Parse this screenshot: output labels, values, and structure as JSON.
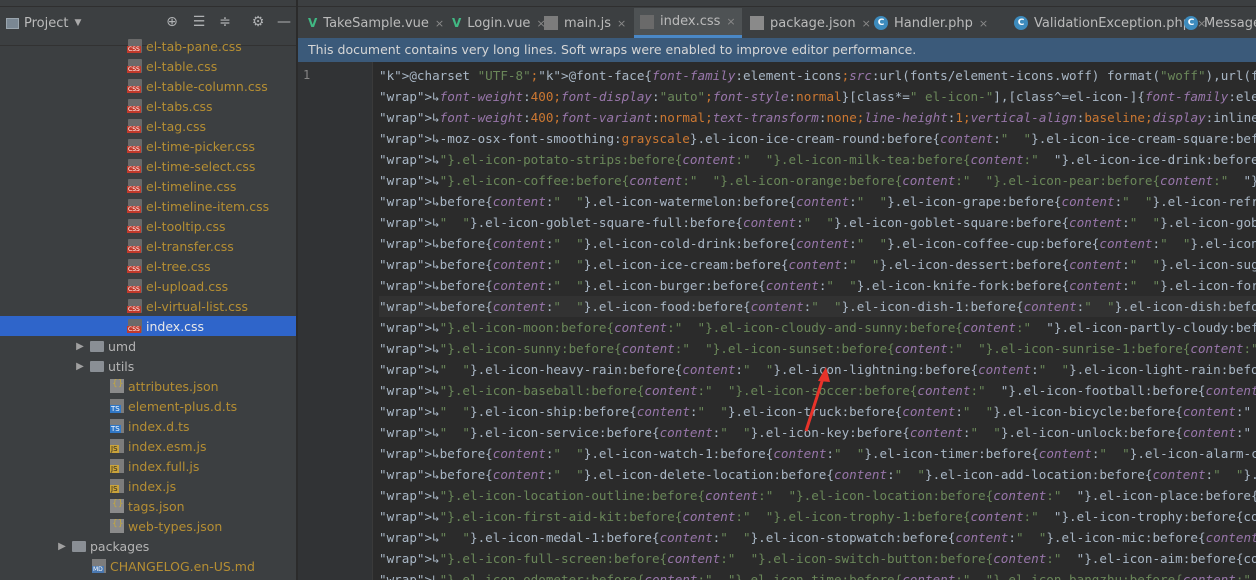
{
  "project": {
    "title": "Project",
    "tree": [
      {
        "label": "el-tab-pane.css",
        "type": "css",
        "indent": 128
      },
      {
        "label": "el-table.css",
        "type": "css",
        "indent": 128
      },
      {
        "label": "el-table-column.css",
        "type": "css",
        "indent": 128
      },
      {
        "label": "el-tabs.css",
        "type": "css",
        "indent": 128
      },
      {
        "label": "el-tag.css",
        "type": "css",
        "indent": 128
      },
      {
        "label": "el-time-picker.css",
        "type": "css",
        "indent": 128
      },
      {
        "label": "el-time-select.css",
        "type": "css",
        "indent": 128
      },
      {
        "label": "el-timeline.css",
        "type": "css",
        "indent": 128
      },
      {
        "label": "el-timeline-item.css",
        "type": "css",
        "indent": 128
      },
      {
        "label": "el-tooltip.css",
        "type": "css",
        "indent": 128
      },
      {
        "label": "el-transfer.css",
        "type": "css",
        "indent": 128
      },
      {
        "label": "el-tree.css",
        "type": "css",
        "indent": 128
      },
      {
        "label": "el-upload.css",
        "type": "css",
        "indent": 128
      },
      {
        "label": "el-virtual-list.css",
        "type": "css",
        "indent": 128
      },
      {
        "label": "index.css",
        "type": "css",
        "indent": 128,
        "selected": true
      },
      {
        "label": "umd",
        "type": "folder",
        "indent": 92
      },
      {
        "label": "utils",
        "type": "folder",
        "indent": 92
      },
      {
        "label": "attributes.json",
        "type": "json",
        "indent": 110
      },
      {
        "label": "element-plus.d.ts",
        "type": "ts",
        "indent": 110
      },
      {
        "label": "index.d.ts",
        "type": "ts",
        "indent": 110
      },
      {
        "label": "index.esm.js",
        "type": "js",
        "indent": 110
      },
      {
        "label": "index.full.js",
        "type": "js",
        "indent": 110
      },
      {
        "label": "index.js",
        "type": "js",
        "indent": 110
      },
      {
        "label": "tags.json",
        "type": "json",
        "indent": 110
      },
      {
        "label": "web-types.json",
        "type": "json",
        "indent": 110
      },
      {
        "label": "packages",
        "type": "folder",
        "indent": 74
      },
      {
        "label": "CHANGELOG.en-US.md",
        "type": "md",
        "indent": 92
      }
    ]
  },
  "tabs": [
    {
      "label": "TakeSample.vue",
      "type": "vue"
    },
    {
      "label": "Login.vue",
      "type": "vue"
    },
    {
      "label": "main.js",
      "type": "js"
    },
    {
      "label": "index.css",
      "type": "css",
      "active": true
    },
    {
      "label": "package.json",
      "type": "json"
    },
    {
      "label": "Handler.php",
      "type": "php"
    },
    {
      "label": "ValidationException.php",
      "type": "php"
    },
    {
      "label": "Message",
      "type": "php"
    }
  ],
  "notice": "This document contains very long lines. Soft wraps were enabled to improve editor performance.",
  "editor": {
    "line_number": "1",
    "lines": [
      "@charset \"UTF-8\";@font-face{font-family:element-icons;src:url(fonts/element-icons.woff) format(\"woff\"),url(font",
      "↳font-weight:400;font-display:\"auto\";font-style:normal}[class*=\" el-icon-\"],[class^=el-icon-]{font-family:elem",
      "↳font-weight:400;font-variant:normal;text-transform:none;line-height:1;vertical-align:baseline;display:inline-",
      "↳-moz-osx-font-smoothing:grayscale}.el-icon-ice-cream-round:before{content:\"  \"}.el-icon-ice-cream-square:befo",
      "↳\"}.el-icon-potato-strips:before{content:\"  \"}.el-icon-milk-tea:before{content:\"  \"}.el-icon-ice-drink:before{",
      "↳\"}.el-icon-coffee:before{content:\"  \"}.el-icon-orange:before{content:\"  \"}.el-icon-pear:before{content:\"  \"}.",
      "↳before{content:\"  \"}.el-icon-watermelon:before{content:\"  \"}.el-icon-grape:before{content:\"  \"}.el-icon-refri",
      "↳\"  \"}.el-icon-goblet-square-full:before{content:\"  \"}.el-icon-goblet-square:before{content:\"  \"}.el-icon-gobl",
      "↳before{content:\"  \"}.el-icon-cold-drink:before{content:\"  \"}.el-icon-coffee-cup:before{content:\"  \"}.el-icon-",
      "↳before{content:\"  \"}.el-icon-ice-cream:before{content:\"  \"}.el-icon-dessert:before{content:\"  \"}.el-icon-suga",
      "↳before{content:\"  \"}.el-icon-burger:before{content:\"  \"}.el-icon-knife-fork:before{content:\"  \"}.el-icon-fork",
      "↳before{content:\"  \"}.el-icon-food:before{content:\"  \"}.el-icon-dish-1:before{content:\"  \"}.el-icon-dish:before",
      "↳\"}.el-icon-moon:before{content:\"  \"}.el-icon-cloudy-and-sunny:before{content:\"  \"}.el-icon-partly-cloudy:before",
      "↳\"}.el-icon-sunny:before{content:\"  \"}.el-icon-sunset:before{content:\"  \"}.el-icon-sunrise-1:before{content:\"",
      "↳\"  \"}.el-icon-heavy-rain:before{content:\"  \"}.el-icon-lightning:before{content:\"  \"}.el-icon-light-rain:before",
      "↳\"}.el-icon-baseball:before{content:\"  \"}.el-icon-soccer:before{content:\"  \"}.el-icon-football:before{content:",
      "↳\"  \"}.el-icon-ship:before{content:\"  \"}.el-icon-truck:before{content:\"  \"}.el-icon-bicycle:before{content:\"",
      "↳\"  \"}.el-icon-service:before{content:\"  \"}.el-icon-key:before{content:\"  \"}.el-icon-unlock:before{content:\"",
      "↳before{content:\"  \"}.el-icon-watch-1:before{content:\"  \"}.el-icon-timer:before{content:\"  \"}.el-icon-alarm-cl",
      "↳before{content:\"  \"}.el-icon-delete-location:before{content:\"  \"}.el-icon-add-location:before{content:\"  \"}.",
      "↳\"}.el-icon-location-outline:before{content:\"  \"}.el-icon-location:before{content:\"  \"}.el-icon-place:before{co",
      "↳\"}.el-icon-first-aid-kit:before{content:\"  \"}.el-icon-trophy-1:before{content:\"  \"}.el-icon-trophy:before{con",
      "↳\"  \"}.el-icon-medal-1:before{content:\"  \"}.el-icon-stopwatch:before{content:\"  \"}.el-icon-mic:before{content:",
      "↳\"}.el-icon-full-screen:before{content:\"  \"}.el-icon-switch-button:before{content:\"  \"}.el-icon-aim:before{con",
      "↳\"}.el-icon-odometer:before{content:\"  \"}.el-icon-time:before{content:\"  \"}.el-icon-bangzhu:before{content:\""
    ]
  }
}
